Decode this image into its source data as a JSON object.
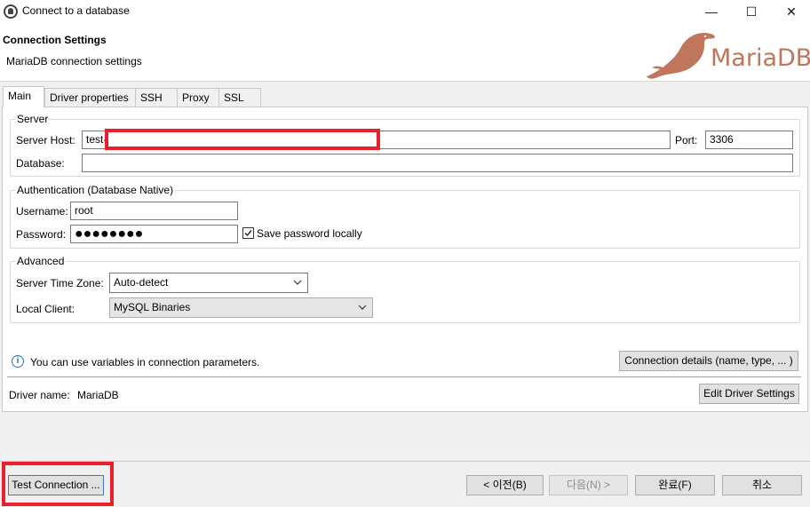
{
  "window": {
    "title": "Connect to a database",
    "minimize_symbol": "—",
    "maximize_symbol": "☐",
    "close_symbol": "✕",
    "app_icon": "dbeaver-beaver-icon"
  },
  "header": {
    "title": "Connection Settings",
    "subtitle": "MariaDB connection settings",
    "logo_text": "MariaDB",
    "logo_color": "#c0765a"
  },
  "tabs": [
    {
      "label": "Main",
      "active": true
    },
    {
      "label": "Driver properties",
      "active": false
    },
    {
      "label": "SSH",
      "active": false
    },
    {
      "label": "Proxy",
      "active": false
    },
    {
      "label": "SSL",
      "active": false
    }
  ],
  "server": {
    "group_label": "Server",
    "host_label": "Server Host:",
    "host_value": "test-",
    "port_label": "Port:",
    "port_value": "3306",
    "database_label": "Database:",
    "database_value": ""
  },
  "auth": {
    "group_label": "Authentication (Database Native)",
    "username_label": "Username:",
    "username_value": "root",
    "password_label": "Password:",
    "password_value": "●●●●●●●●",
    "save_password_label": "Save password locally",
    "save_password_checked": true
  },
  "advanced": {
    "group_label": "Advanced",
    "timezone_label": "Server Time Zone:",
    "timezone_value": "Auto-detect",
    "client_label": "Local Client:",
    "client_value": "MySQL Binaries"
  },
  "info": {
    "text": "You can use variables in connection parameters.",
    "details_button": "Connection details (name, type, ... )"
  },
  "driver": {
    "label": "Driver name:",
    "value": "MariaDB",
    "edit_button": "Edit Driver Settings"
  },
  "footer": {
    "test_button": "Test Connection ...",
    "back_button": "< 이전(B)",
    "next_button": "다음(N) >",
    "finish_button": "완료(F)",
    "cancel_button": "취소"
  },
  "highlight_color": "#e8202a"
}
